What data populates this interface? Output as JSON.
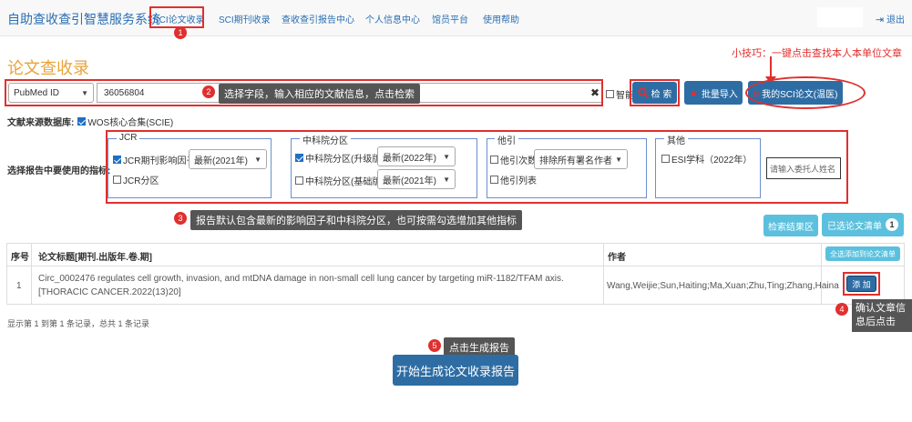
{
  "nav": {
    "brand": "自助查收查引智慧服务系统",
    "items": [
      "SCI论文收录",
      "SCI期刊收录",
      "查收查引报告中心",
      "个人信息中心",
      "馆员平台",
      "使用帮助"
    ],
    "logout": "退出"
  },
  "page": {
    "title": "论文查收录",
    "tip": "小技巧：一键点击查找本人本单位文章"
  },
  "search": {
    "field": "PubMed ID",
    "value": "36056804",
    "smart_label": "智能",
    "search_label": "检 索",
    "batch_label": "批量导入",
    "my_sci_label": "我的SCI论文(温医)",
    "annotation": "选择字段，输入相应的文献信息，点击检索"
  },
  "source": {
    "label": "文献来源数据库:",
    "option": "WOS核心合集(SCIE)"
  },
  "indicators": {
    "label": "选择报告中要使用的指标:",
    "jcr": {
      "legend": "JCR",
      "if_label": "JCR期刊影响因子",
      "if_select": "最新(2021年)",
      "quartile_label": "JCR分区"
    },
    "cas": {
      "legend": "中科院分区",
      "upgrade_label": "中科院分区(升级版)",
      "upgrade_select": "最新(2022年)",
      "basic_label": "中科院分区(基础版)",
      "basic_select": "最新(2021年)"
    },
    "cite": {
      "legend": "他引",
      "count_label": "他引次数",
      "count_select": "排除所有署名作者",
      "list_label": "他引列表"
    },
    "other": {
      "legend": "其他",
      "esi_label": "ESI学科（2022年）"
    },
    "entrust_placeholder": "请输入委托人姓名",
    "annotation": "报告默认包含最新的影响因子和中科院分区，也可按需勾选增加其他指标"
  },
  "results": {
    "search_result_btn": "检索结果区",
    "selected_btn": "已选论文清单",
    "selected_count": "1",
    "headers": {
      "no": "序号",
      "title": "论文标题[期刊.出版年.卷.期]",
      "author": "作者"
    },
    "add_all": "全选添加到论文清单",
    "rows": [
      {
        "no": "1",
        "title": "Circ_0002476 regulates cell growth, invasion, and mtDNA damage in non-small cell lung cancer by targeting miR-1182/TFAM axis. [THORACIC CANCER.2022(13)20]",
        "author": "Wang,Weijie;Sun,Haiting;Ma,Xuan;Zhu,Ting;Zhang,Haina",
        "add": "添 加"
      }
    ],
    "records": "显示第 1 到第 1 条记录，总共 1 条记录",
    "confirm_annotation": "确认文章信息后点击"
  },
  "generate": {
    "annotation": "点击生成报告",
    "button": "开始生成论文收录报告"
  },
  "steps": [
    "1",
    "2",
    "3",
    "4",
    "5"
  ],
  "colors": {
    "primary": "#2e6da4",
    "accent": "#e8a33a",
    "annotation": "#e0302e",
    "info": "#5bc0de"
  }
}
